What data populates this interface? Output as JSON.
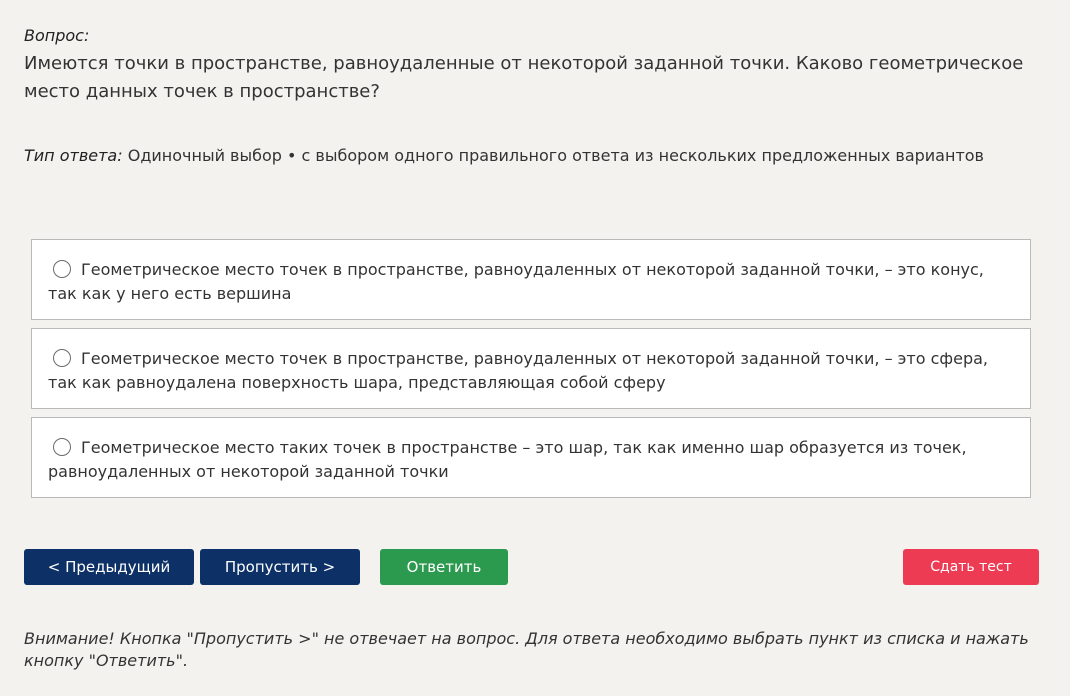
{
  "question": {
    "label": "Вопрос:",
    "text": "Имеются точки в пространстве, равноудаленные от некоторой заданной точки. Каково геометрическое место данных точек в пространстве?"
  },
  "answer_type": {
    "label": "Тип ответа:",
    "value": "Одиночный выбор • с выбором одного правильного ответа из нескольких предложенных вариантов"
  },
  "options": [
    {
      "text": "Геометрическое место точек в пространстве, равноудаленных от некоторой заданной точки, – это конус, так как у него есть вершина",
      "selected": false
    },
    {
      "text": "Геометрическое место точек в пространстве, равноудаленных от некоторой заданной точки, – это сфера, так как равноудалена поверхность шара, представляющая собой сферу",
      "selected": false
    },
    {
      "text": "Геометрическое место таких точек в пространстве – это шар, так как именно шар образуется из точек, равноудаленных от некоторой заданной точки",
      "selected": false
    }
  ],
  "buttons": {
    "prev": "< Предыдущий",
    "skip": "Пропустить >",
    "answer": "Ответить",
    "submit": "Сдать тест"
  },
  "note": "Внимание! Кнопка \"Пропустить >\" не отвечает на вопрос. Для ответа необходимо выбрать пункт из списка и нажать кнопку \"Ответить\".",
  "colors": {
    "background": "#f3f2ef",
    "primary_button": "#0d3166",
    "answer_button": "#2b9a4f",
    "submit_button": "#ee3b54"
  }
}
